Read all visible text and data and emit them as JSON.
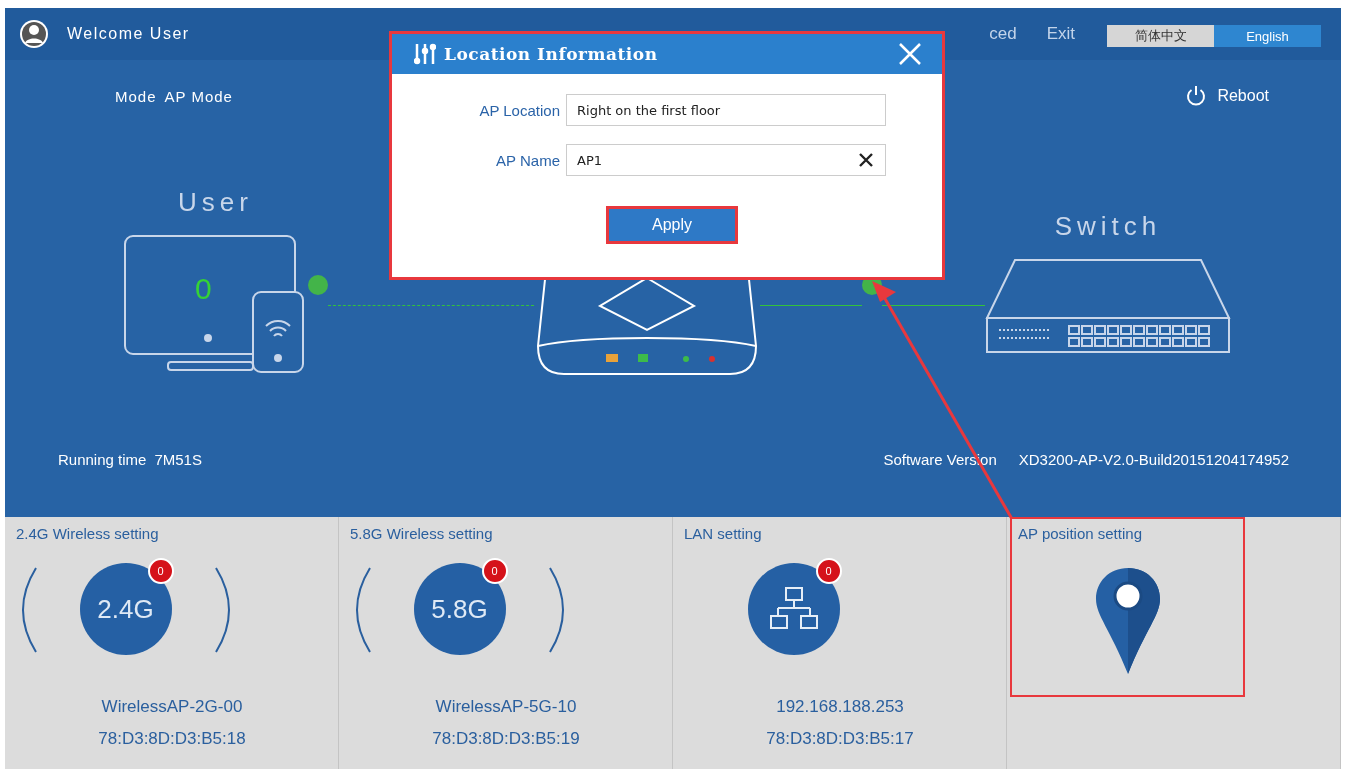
{
  "header": {
    "welcome": "Welcome User",
    "nav": [
      "ced",
      "Exit"
    ],
    "languages": [
      {
        "label": "简体中文",
        "selected": false
      },
      {
        "label": "English",
        "selected": true
      }
    ]
  },
  "mode": {
    "label": "Mode",
    "value": "AP Mode"
  },
  "reboot": "Reboot",
  "topology": {
    "user_title": "User",
    "user_count": "0",
    "switch_title": "Switch"
  },
  "running_time": {
    "label": "Running time",
    "value": "7M51S"
  },
  "software_version": {
    "label": "Software Version",
    "value": "XD3200-AP-V2.0-Build20151204174952"
  },
  "panels": [
    {
      "kind": "wireless",
      "title": "2.4G Wireless setting",
      "icon_text": "2.4G",
      "badge": "0",
      "lines": [
        "WirelessAP-2G-00",
        "78:D3:8D:D3:B5:18"
      ],
      "highlighted": false
    },
    {
      "kind": "wireless",
      "title": "5.8G Wireless setting",
      "icon_text": "5.8G",
      "badge": "0",
      "lines": [
        "WirelessAP-5G-10",
        "78:D3:8D:D3:B5:19"
      ],
      "highlighted": false
    },
    {
      "kind": "lan",
      "title": "LAN setting",
      "badge": "0",
      "lines": [
        "192.168.188.253",
        "78:D3:8D:D3:B5:17"
      ],
      "highlighted": false
    },
    {
      "kind": "position",
      "title": "AP position setting",
      "highlighted": true
    }
  ],
  "dialog": {
    "title": "Location Information",
    "highlighted": true,
    "fields": [
      {
        "label": "AP Location",
        "value": "Right on the first floor",
        "clearable": false
      },
      {
        "label": "AP Name",
        "value": "AP1",
        "clearable": true
      }
    ],
    "apply": {
      "label": "Apply",
      "highlighted": true
    }
  }
}
